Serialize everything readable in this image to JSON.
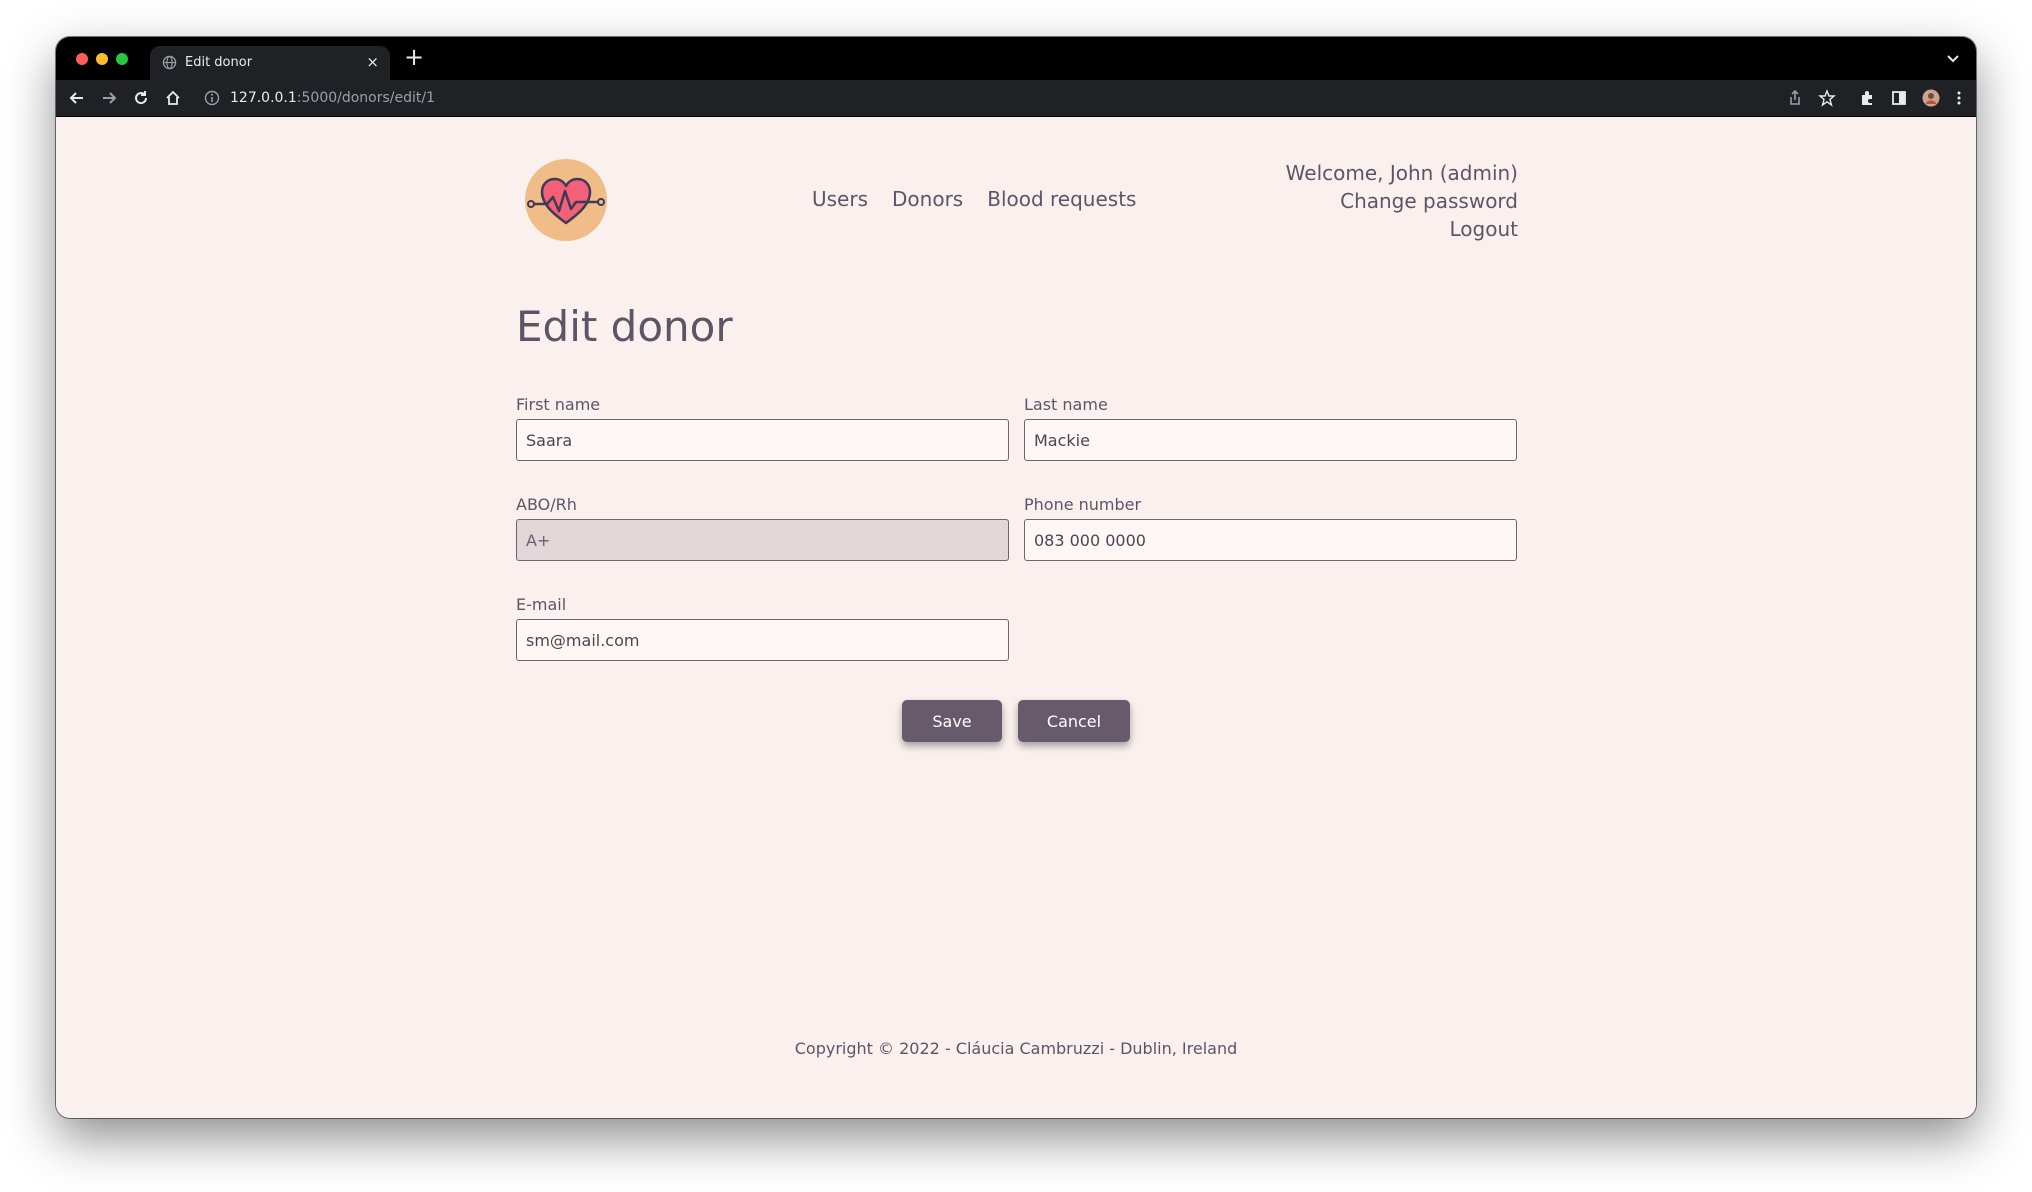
{
  "browser": {
    "tab_title": "Edit donor",
    "new_tab_label": "+",
    "close_label": "×",
    "url_host": "127.0.0.1",
    "url_path": ":5000/donors/edit/1"
  },
  "nav": {
    "users": "Users",
    "donors": "Donors",
    "blood_requests": "Blood requests"
  },
  "user_menu": {
    "welcome": "Welcome, John (admin)",
    "change_password": "Change password",
    "logout": "Logout"
  },
  "form": {
    "title": "Edit donor",
    "first_name": {
      "label": "First name",
      "value": "Saara"
    },
    "last_name": {
      "label": "Last name",
      "value": "Mackie"
    },
    "abo_rh": {
      "label": "ABO/Rh",
      "value": "A+"
    },
    "phone": {
      "label": "Phone number",
      "value": "083 000 0000"
    },
    "email": {
      "label": "E-mail",
      "value": "sm@mail.com"
    },
    "save_label": "Save",
    "cancel_label": "Cancel"
  },
  "footer": {
    "text": "Copyright © 2022 - Cláucia Cambruzzi - Dublin, Ireland"
  },
  "colors": {
    "page_background": "#faf1ee",
    "text": "#5e5468",
    "button": "#665a6b",
    "logo_circle": "#f0bd88",
    "heart": "#f2607a"
  }
}
